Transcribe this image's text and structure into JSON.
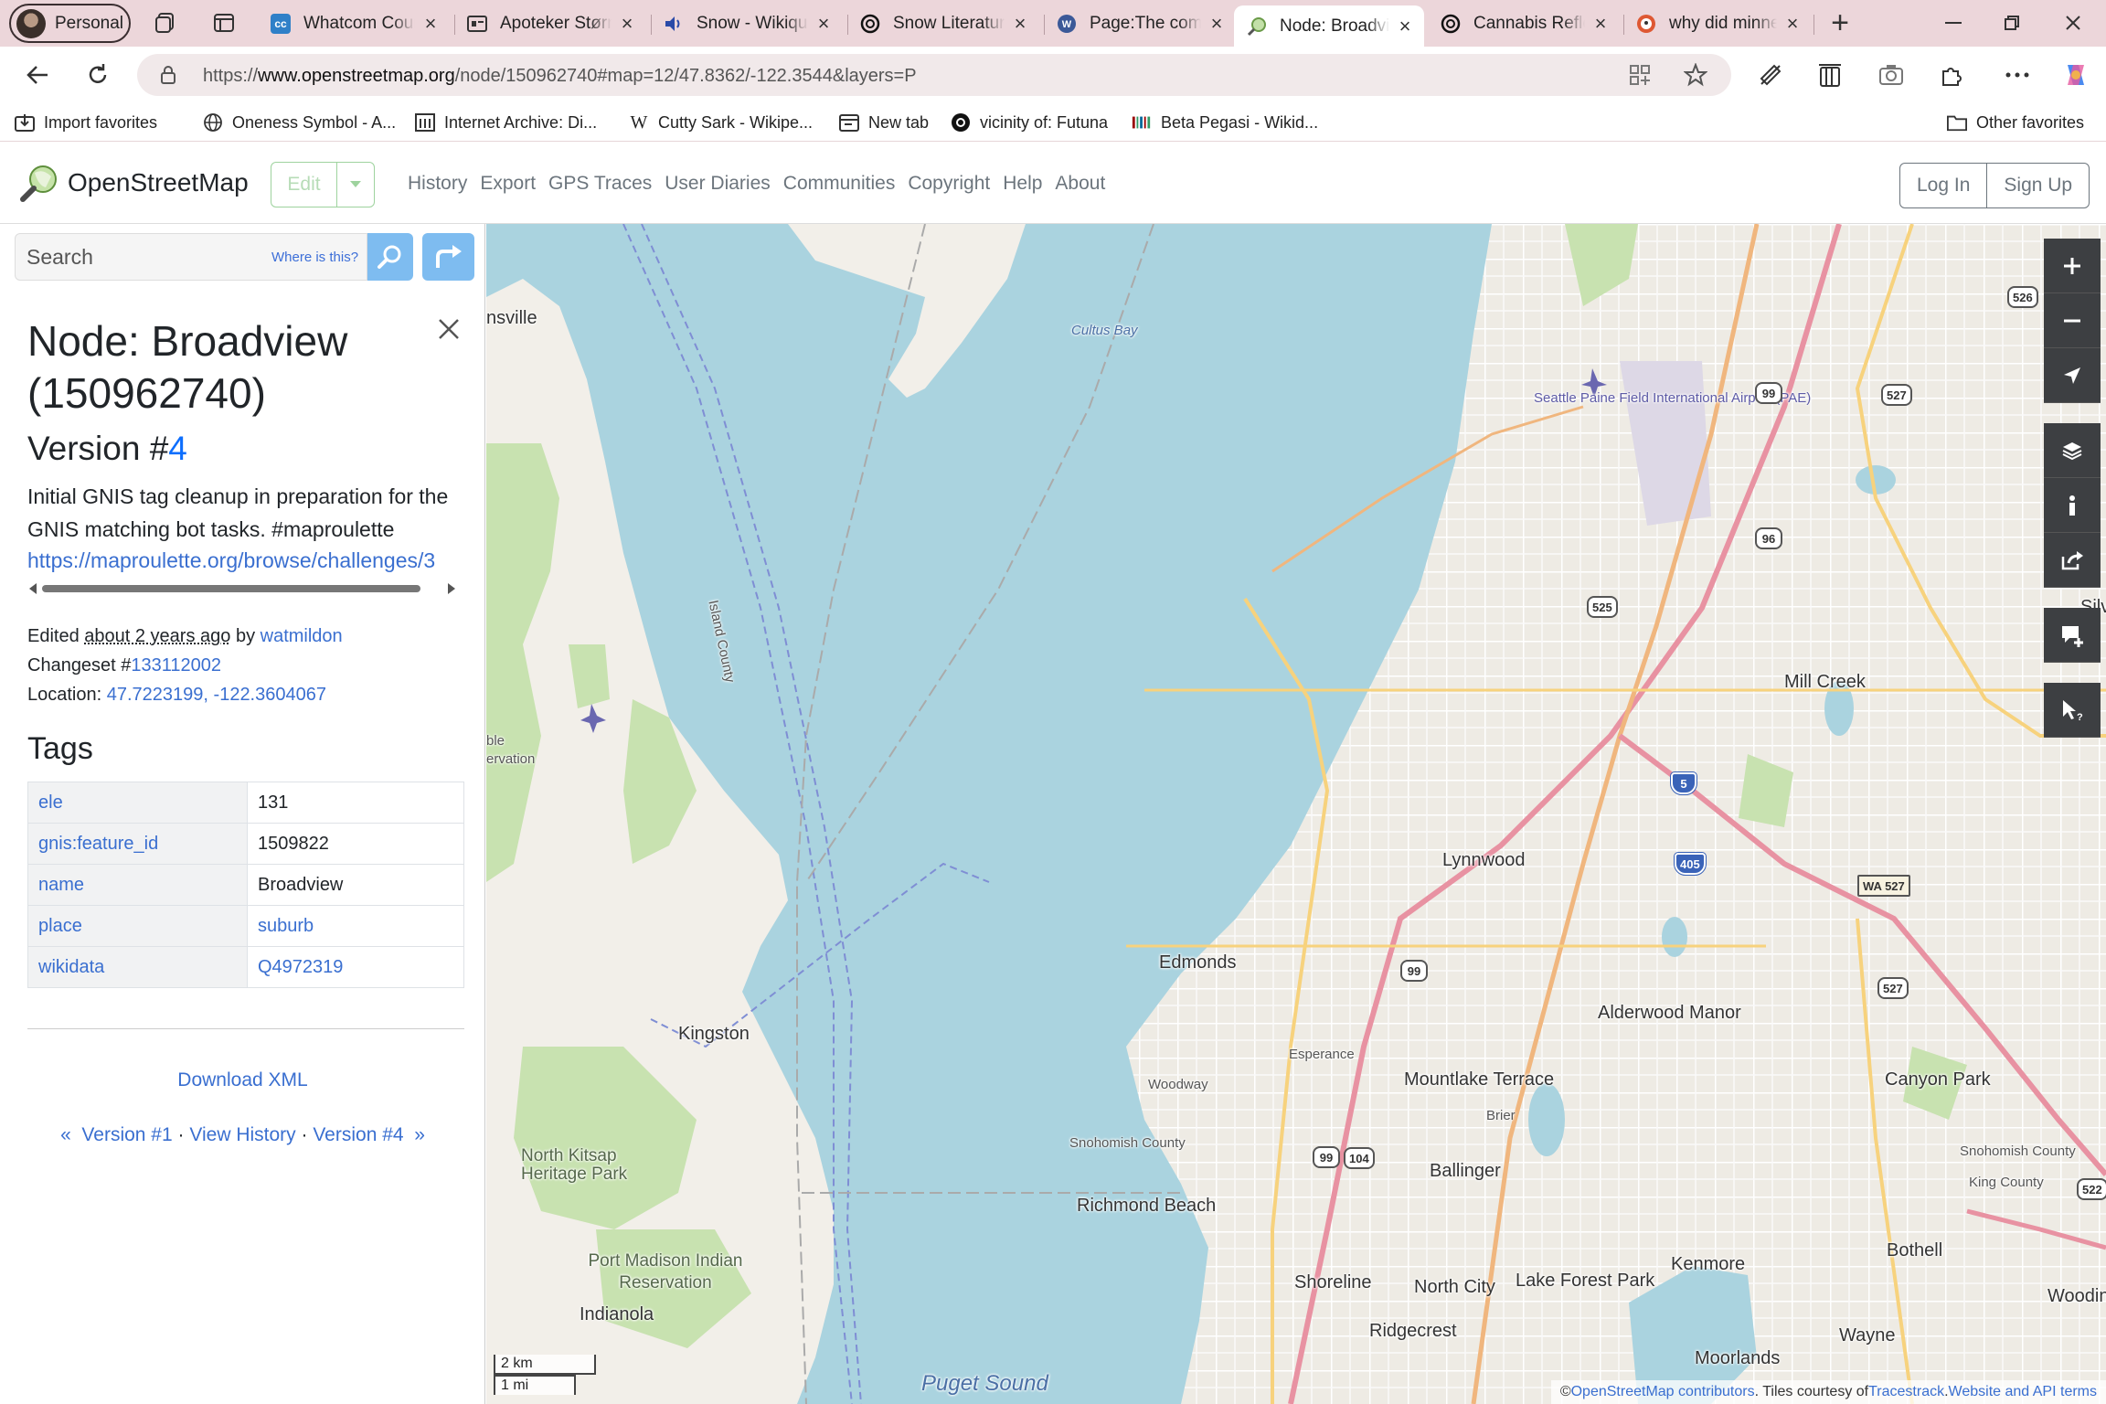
{
  "browser": {
    "profile_label": "Personal",
    "tabs": [
      {
        "title": "Whatcom County",
        "icon": "cc-icon"
      },
      {
        "title": "Apoteker Størm",
        "icon": "archive-icon"
      },
      {
        "title": "Snow - Wikiquote",
        "icon": "audio-icon"
      },
      {
        "title": "Snow Literature",
        "icon": "chatgpt-icon"
      },
      {
        "title": "Page:The complete",
        "icon": "wikisource-icon"
      },
      {
        "title": "Node: Broadview",
        "icon": "osm-icon"
      },
      {
        "title": "Cannabis Reflex",
        "icon": "chatgpt-icon"
      },
      {
        "title": "why did minnes",
        "icon": "duckduckgo-icon"
      }
    ],
    "url_prefix": "https://",
    "url_domain": "www.openstreetmap.org",
    "url_path": "/node/150962740#map=12/47.8362/-122.3544&layers=P",
    "favorites": [
      {
        "label": "Import favorites"
      },
      {
        "label": "Oneness Symbol - A..."
      },
      {
        "label": "Internet Archive: Di..."
      },
      {
        "label": "Cutty Sark - Wikipe..."
      },
      {
        "label": "New tab"
      },
      {
        "label": "vicinity of: Futuna"
      },
      {
        "label": "Beta Pegasi - Wikid..."
      },
      {
        "label": "Other favorites"
      }
    ]
  },
  "osm": {
    "brand": "OpenStreetMap",
    "edit_label": "Edit",
    "nav": [
      "History",
      "Export",
      "GPS Traces",
      "User Diaries",
      "Communities",
      "Copyright",
      "Help",
      "About"
    ],
    "login_label": "Log In",
    "signup_label": "Sign Up"
  },
  "sidebar": {
    "search_placeholder": "Search",
    "where_is_this": "Where is this?",
    "title": "Node: Broadview (150962740)",
    "version_prefix": "Version #",
    "version_number": "4",
    "comment": "Initial GNIS tag cleanup in preparation for the GNIS matching bot tasks. #maproulette",
    "comment_link": "https://maproulette.org/browse/challenges/3",
    "edited_prefix": "Edited ",
    "edited_time": "about 2 years ago",
    "edited_by": " by ",
    "editor": "watmildon",
    "changeset_prefix": "Changeset #",
    "changeset": "133112002",
    "location_prefix": "Location: ",
    "lat": "47.7223199",
    "lon": "-122.3604067",
    "tags_heading": "Tags",
    "tags": [
      {
        "key": "ele",
        "value": "131",
        "link": false
      },
      {
        "key": "gnis:feature_id",
        "value": "1509822",
        "link": false
      },
      {
        "key": "name",
        "value": "Broadview",
        "link": false
      },
      {
        "key": "place",
        "value": "suburb",
        "link": true
      },
      {
        "key": "wikidata",
        "value": "Q4972319",
        "link": true
      }
    ],
    "download_xml": "Download XML",
    "version_first": "Version #1",
    "view_history": "View History",
    "version_last": "Version #4"
  },
  "map": {
    "places": {
      "poulsbo_partial": "nsville",
      "cultus_bay": "Cultus Bay",
      "airport": "Seattle Paine Field International Airport (PAE)",
      "mill_creek": "Mill Creek",
      "lynnwood": "Lynnwood",
      "edmonds": "Edmonds",
      "kingston": "Kingston",
      "alderwood_manor": "Alderwood Manor",
      "esperance": "Esperance",
      "mountlake_terrace": "Mountlake Terrace",
      "canyon_park": "Canyon Park",
      "woodway": "Woodway",
      "brier": "Brier",
      "snohomish_county": "Snohomish County",
      "snohomish_county_east": "Snohomish County",
      "king_county": "King County",
      "north_kitsap": "North Kitsap Heritage Park",
      "ballinger": "Ballinger",
      "richmond_beach": "Richmond Beach",
      "port_madison": "Port Madison Indian Reservation",
      "indianola": "Indianola",
      "shoreline": "Shoreline",
      "north_city": "North City",
      "lake_forest_park": "Lake Forest Park",
      "kenmore": "Kenmore",
      "bothell": "Bothell",
      "woodinville_partial": "Woodinv",
      "ridgecrest": "Ridgecrest",
      "wayne": "Wayne",
      "moorlands": "Moorlands",
      "puget_sound": "Puget Sound",
      "island_county": "Island County",
      "reservation_partial": "ble ervation",
      "silver_partial": "Silve"
    },
    "shields": [
      "526",
      "99",
      "527",
      "96",
      "525",
      "5",
      "405",
      "WA 527",
      "99",
      "527",
      "99",
      "104",
      "522"
    ],
    "scale_km": "2 km",
    "scale_mi": "1 mi",
    "attribution_prefix": "© ",
    "attribution_link1": "OpenStreetMap contributors",
    "attribution_mid": ". Tiles courtesy of ",
    "attribution_link2": "Tracestrack",
    "attribution_sep": ". ",
    "attribution_link3": "Website and API terms",
    "colors": {
      "water": "#aad3df",
      "land": "#f2efe9",
      "park": "#c8e2b0",
      "motorway": "#e892a2",
      "primary": "#fcd6a4"
    }
  }
}
